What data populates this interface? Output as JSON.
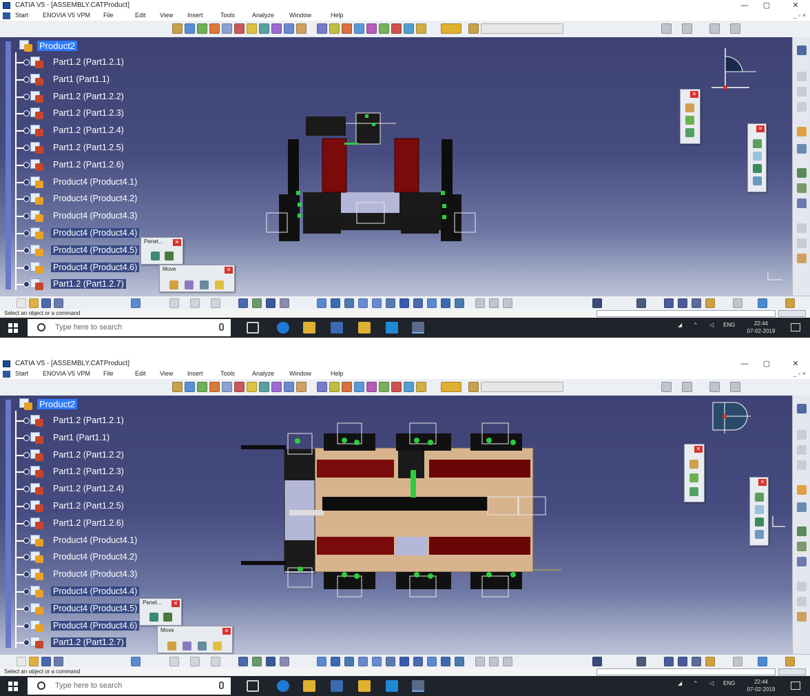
{
  "screens": [
    {
      "window": {
        "title": "CATIA V5 - [ASSEMBLY.CATProduct]",
        "minimize": "—",
        "maximize": "▢",
        "close": "✕",
        "mini_controls": "_ ▫ ×"
      },
      "menu": [
        "Start",
        "ENOVIA V5 VPM",
        "File",
        "Edit",
        "View",
        "Insert",
        "Tools",
        "Analyze",
        "Window",
        "Help"
      ],
      "tree": {
        "root": "Product2",
        "nodes": [
          {
            "label": "Part1.2 (Part1.2.1)",
            "kind": "part"
          },
          {
            "label": "Part1 (Part1.1)",
            "kind": "part"
          },
          {
            "label": "Part1.2 (Part1.2.2)",
            "kind": "part"
          },
          {
            "label": "Part1.2 (Part1.2.3)",
            "kind": "part"
          },
          {
            "label": "Part1.2 (Part1.2.4)",
            "kind": "part"
          },
          {
            "label": "Part1.2 (Part1.2.5)",
            "kind": "part"
          },
          {
            "label": "Part1.2 (Part1.2.6)",
            "kind": "part"
          },
          {
            "label": "Product4 (Product4.1)",
            "kind": "product"
          },
          {
            "label": "Product4 (Product4.2)",
            "kind": "product"
          },
          {
            "label": "Product4 (Product4.3)",
            "kind": "product"
          },
          {
            "label": "Product4 (Product4.4)",
            "kind": "product"
          },
          {
            "label": "Product4 (Product4.5)",
            "kind": "product"
          },
          {
            "label": "Product4 (Product4.6)",
            "kind": "product"
          },
          {
            "label": "Part1.2 (Part1.2.7)",
            "kind": "part"
          }
        ]
      },
      "floaters": {
        "penetration": "Penet...",
        "move": "Move"
      },
      "status": "Select an object or a command",
      "taskbar": {
        "search_placeholder": "Type here to search",
        "language": "ENG",
        "time": "22:44",
        "date": "07-02-2019"
      }
    },
    {
      "window": {
        "title": "CATIA V5 - [ASSEMBLY.CATProduct]",
        "minimize": "—",
        "maximize": "▢",
        "close": "✕",
        "mini_controls": "_ ▫ ×"
      },
      "menu": [
        "Start",
        "ENOVIA V5 VPM",
        "File",
        "Edit",
        "View",
        "Insert",
        "Tools",
        "Analyze",
        "Window",
        "Help"
      ],
      "tree": {
        "root": "Product2",
        "nodes": [
          {
            "label": "Part1.2 (Part1.2.1)",
            "kind": "part"
          },
          {
            "label": "Part1 (Part1.1)",
            "kind": "part"
          },
          {
            "label": "Part1.2 (Part1.2.2)",
            "kind": "part"
          },
          {
            "label": "Part1.2 (Part1.2.3)",
            "kind": "part"
          },
          {
            "label": "Part1.2 (Part1.2.4)",
            "kind": "part"
          },
          {
            "label": "Part1.2 (Part1.2.5)",
            "kind": "part"
          },
          {
            "label": "Part1.2 (Part1.2.6)",
            "kind": "part"
          },
          {
            "label": "Product4 (Product4.1)",
            "kind": "product"
          },
          {
            "label": "Product4 (Product4.2)",
            "kind": "product"
          },
          {
            "label": "Product4 (Product4.3)",
            "kind": "product"
          },
          {
            "label": "Product4 (Product4.4)",
            "kind": "product"
          },
          {
            "label": "Product4 (Product4.5)",
            "kind": "product"
          },
          {
            "label": "Product4 (Product4.6)",
            "kind": "product"
          },
          {
            "label": "Part1.2 (Part1.2.7)",
            "kind": "part"
          }
        ]
      },
      "floaters": {
        "penetration": "Penet...",
        "move": "Move"
      },
      "status": "Select an object or a command",
      "taskbar": {
        "search_placeholder": "Type here to search",
        "language": "ENG",
        "time": "22:44",
        "date": "07-02-2019"
      }
    }
  ],
  "icons": {
    "app": "catia-app-icon",
    "start": "start-workbench-icon",
    "tree_part": "part-icon",
    "tree_product": "product-icon",
    "compass": "compass-icon",
    "windows": "windows-logo-icon",
    "search": "search-icon",
    "mic": "microphone-icon",
    "task_view": "task-view-icon",
    "edge": "edge-browser-icon",
    "explorer": "file-explorer-icon",
    "store": "store-icon",
    "catia_task": "catia-taskbar-icon",
    "network": "network-icon",
    "volume": "volume-icon",
    "notifications": "notifications-icon"
  },
  "colors": {
    "viewport_top": "#3e4273",
    "viewport_bottom": "#bcc3d8",
    "tree_highlight": "#2e7bff",
    "part_red": "#8b0a0a",
    "plate_tan": "#d8b48e",
    "taskbar": "#1f232a"
  }
}
